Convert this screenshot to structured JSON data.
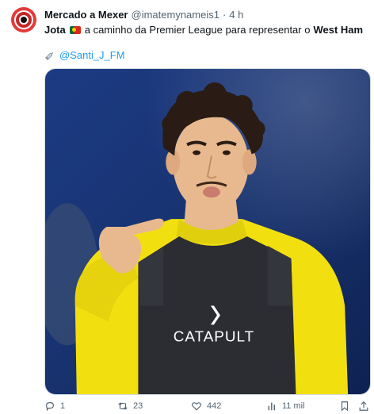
{
  "author": {
    "name": "Mercado a Mexer",
    "handle": "@imatemynameis1",
    "separator": "·",
    "time": "4 h"
  },
  "tweet": {
    "text_before": "Jota",
    "text_middle": "a caminho da Premier League para representar o",
    "text_after": "West Ham",
    "flag_icon": "portugal-flag",
    "credit_icon": "syringe-icon",
    "credit_handle": "@Santi_J_FM"
  },
  "media": {
    "shirt_text": "CATAPULT",
    "colors": {
      "background": "#17306a",
      "shirt": "#f2df10",
      "vest": "#2b2d33"
    }
  },
  "actions": {
    "replies": "1",
    "reposts": "23",
    "likes": "442",
    "views": "11 mil"
  },
  "colors": {
    "accent": "#1d9bf0",
    "secondary_text": "#536471"
  }
}
